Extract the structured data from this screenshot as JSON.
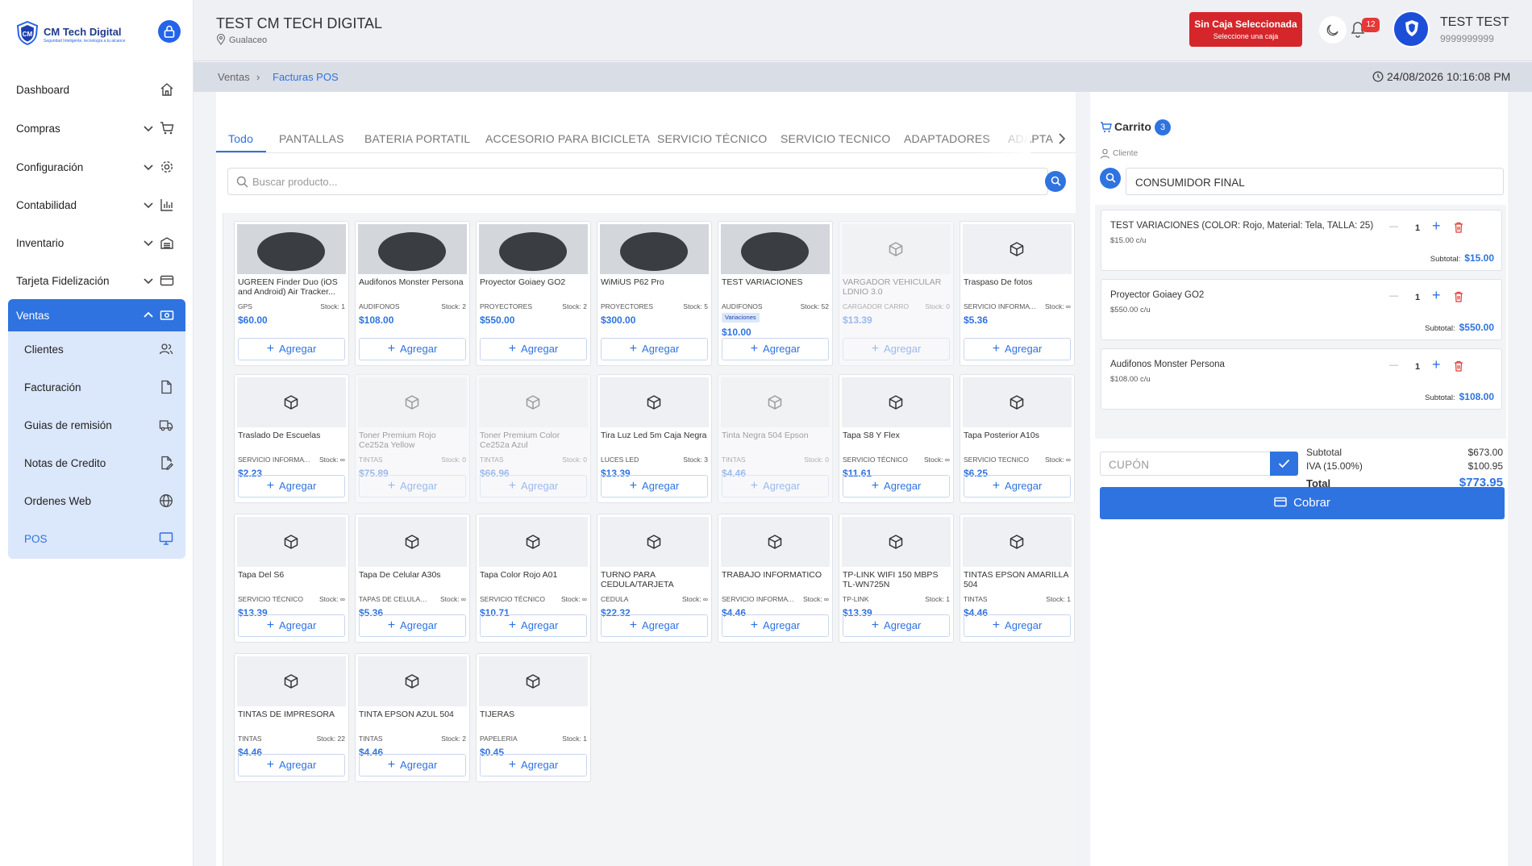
{
  "app": {
    "logo_name": "CM Tech Digital",
    "logo_tagline": "Seguridad Inteligente, tecnología a tu alcance"
  },
  "sidebar": {
    "items": [
      {
        "label": "Dashboard",
        "icon": "home-icon"
      },
      {
        "label": "Compras",
        "icon": "cart-icon"
      },
      {
        "label": "Configuración",
        "icon": "gear-icon"
      },
      {
        "label": "Contabilidad",
        "icon": "bar-chart-icon"
      },
      {
        "label": "Inventario",
        "icon": "warehouse-icon"
      },
      {
        "label": "Tarjeta Fidelización",
        "icon": "card-icon"
      }
    ],
    "ventas": {
      "label": "Ventas",
      "icon": "cash-icon",
      "subitems": [
        {
          "label": "Clientes",
          "icon": "users-icon"
        },
        {
          "label": "Facturación",
          "icon": "file-icon"
        },
        {
          "label": "Guias de remisión",
          "icon": "truck-icon"
        },
        {
          "label": "Notas de Credito",
          "icon": "edit-file-icon"
        },
        {
          "label": "Ordenes Web",
          "icon": "globe-icon"
        },
        {
          "label": "POS",
          "icon": "monitor-icon"
        }
      ]
    }
  },
  "header": {
    "title": "TEST CM TECH DIGITAL",
    "location": "Gualaceo",
    "caja_title": "Sin Caja Seleccionada",
    "caja_sub": "Seleccione una caja",
    "notifications": "12",
    "user_name": "TEST TEST",
    "user_phone": "9999999999"
  },
  "breadcrumb": {
    "parent": "Ventas",
    "separator": "›",
    "current": "Facturas POS",
    "datetime": "24/08/2026 10:16:08 PM"
  },
  "tabs": [
    "Todo",
    "PANTALLAS",
    "BATERIA PORTATIL",
    "ACCESORIO PARA BICICLETA",
    "SERVICIO TÉCNICO",
    "SERVICIO TECNICO",
    "ADAPTADORES",
    "ADAPTA"
  ],
  "search": {
    "placeholder": "Buscar producto..."
  },
  "add_label": "Agregar",
  "variant_badge": "Variaciones",
  "products": [
    {
      "name": "UGREEN Finder Duo (iOS and Android) Air Tracker...",
      "cat": "GPS",
      "stock": "Stock: 1",
      "price": "$60.00",
      "photo": true
    },
    {
      "name": "Audifonos Monster Persona",
      "cat": "AUDIFONOS",
      "stock": "Stock: 2",
      "price": "$108.00",
      "photo": true
    },
    {
      "name": "Proyector Goiaey GO2",
      "cat": "PROYECTORES",
      "stock": "Stock: 2",
      "price": "$550.00",
      "photo": true
    },
    {
      "name": "WiMiUS P62 Pro",
      "cat": "PROYECTORES",
      "stock": "Stock: 5",
      "price": "$300.00",
      "photo": true
    },
    {
      "name": "TEST VARIACIONES",
      "cat": "AUDIFONOS",
      "stock": "Stock: 52",
      "price": "$10.00",
      "photo": true,
      "variant": true
    },
    {
      "name": "VARGADOR VEHICULAR LDNIO 3.0",
      "cat": "CARGADOR CARRO",
      "stock": "Stock: 0",
      "price": "$13.39",
      "disabled": true
    },
    {
      "name": "Traspaso De fotos",
      "cat": "SERVICIO INFORMATICO",
      "stock": "Stock: ∞",
      "price": "$5.36"
    },
    {
      "name": "Traslado De Escuelas",
      "cat": "SERVICIO INFORMATICO",
      "stock": "Stock: ∞",
      "price": "$2.23"
    },
    {
      "name": "Toner Premium Rojo Ce252a Yellow",
      "cat": "TINTAS",
      "stock": "Stock: 0",
      "price": "$75.89",
      "disabled": true
    },
    {
      "name": "Toner Premium Color Ce252a Azul",
      "cat": "TINTAS",
      "stock": "Stock: 0",
      "price": "$66.96",
      "disabled": true
    },
    {
      "name": "Tira Luz Led 5m Caja Negra",
      "cat": "LUCES LED",
      "stock": "Stock: 3",
      "price": "$13.39"
    },
    {
      "name": "Tinta Negra 504 Epson",
      "cat": "TINTAS",
      "stock": "Stock: 0",
      "price": "$4.46",
      "disabled": true
    },
    {
      "name": "Tapa S8 Y Flex",
      "cat": "SERVICIO TÉCNICO",
      "stock": "Stock: ∞",
      "price": "$11.61"
    },
    {
      "name": "Tapa Posterior A10s",
      "cat": "SERVICIO TECNICO",
      "stock": "Stock: ∞",
      "price": "$6.25"
    },
    {
      "name": "Tapa Del S6",
      "cat": "SERVICIO TÉCNICO",
      "stock": "Stock: ∞",
      "price": "$13.39"
    },
    {
      "name": "Tapa De Celular A30s",
      "cat": "TAPAS DE CELULARES",
      "stock": "Stock: ∞",
      "price": "$5.36"
    },
    {
      "name": "Tapa Color Rojo A01",
      "cat": "SERVICIO TÉCNICO",
      "stock": "Stock: ∞",
      "price": "$10.71"
    },
    {
      "name": "TURNO PARA CEDULA/TARJETA",
      "cat": "CEDULA",
      "stock": "Stock: ∞",
      "price": "$22.32"
    },
    {
      "name": "TRABAJO INFORMATICO",
      "cat": "SERVICIO INFORMATICO",
      "stock": "Stock: ∞",
      "price": "$4.46"
    },
    {
      "name": "TP-LINK WIFI 150 MBPS TL-WN725N",
      "cat": "TP-LINK",
      "stock": "Stock: 1",
      "price": "$13.39"
    },
    {
      "name": "TINTAS EPSON AMARILLA 504",
      "cat": "TINTAS",
      "stock": "Stock: 1",
      "price": "$4.46"
    },
    {
      "name": "TINTAS DE IMPRESORA",
      "cat": "TINTAS",
      "stock": "Stock: 22",
      "price": "$4.46"
    },
    {
      "name": "TINTA EPSON AZUL 504",
      "cat": "TINTAS",
      "stock": "Stock: 2",
      "price": "$4.46"
    },
    {
      "name": "TIJERAS",
      "cat": "PAPELERIA",
      "stock": "Stock: 1",
      "price": "$0.45"
    }
  ],
  "cart": {
    "title": "Carrito",
    "count": "3",
    "cliente_label": "Cliente",
    "cliente_value": "CONSUMIDOR FINAL",
    "subtotal_prefix": "Subtotal:",
    "items": [
      {
        "name": "TEST VARIACIONES (COLOR: Rojo, Material: Tela, TALLA: 25)",
        "unit": "$15.00 c/u",
        "qty": "1",
        "subtotal": "$15.00"
      },
      {
        "name": "Proyector Goiaey GO2",
        "unit": "$550.00 c/u",
        "qty": "1",
        "subtotal": "$550.00"
      },
      {
        "name": "Audifonos Monster Persona",
        "unit": "$108.00 c/u",
        "qty": "1",
        "subtotal": "$108.00"
      }
    ],
    "coupon_placeholder": "CUPÓN",
    "subtotal_label": "Subtotal",
    "subtotal_value": "$673.00",
    "iva_label": "IVA (15.00%)",
    "iva_value": "$100.95",
    "total_label": "Total",
    "total_value": "$773.95",
    "pay_label": "Cobrar"
  }
}
